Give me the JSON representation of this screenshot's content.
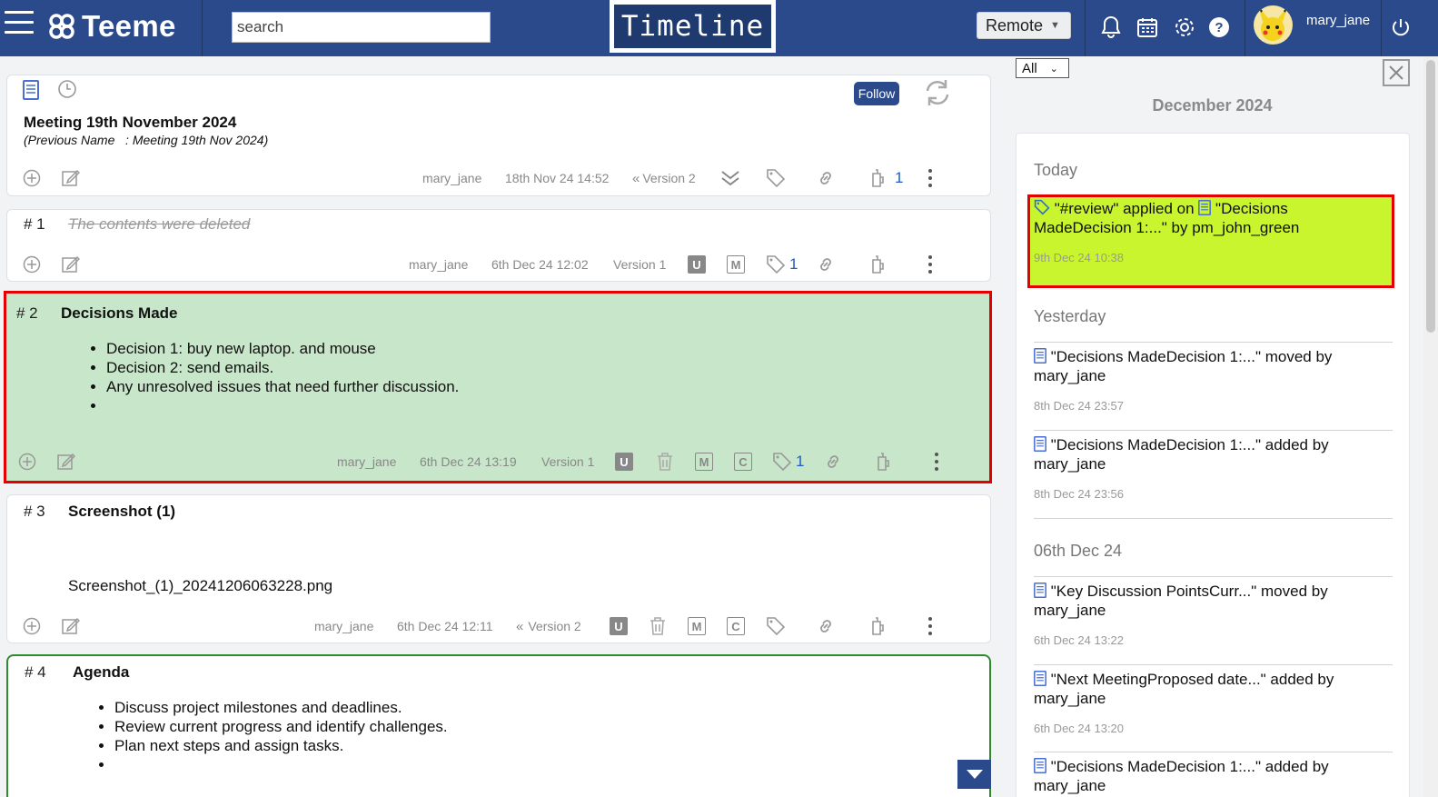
{
  "header": {
    "brand": "Teeme",
    "search_placeholder": "search",
    "page_title": "Timeline",
    "mode_select": "Remote",
    "username": "mary_jane",
    "icons": [
      "bell-icon",
      "calendar-icon",
      "gear-icon",
      "help-icon",
      "power-icon"
    ]
  },
  "document": {
    "title": "Meeting 19th November 2024",
    "previous_name": "(Previous Name   : Meeting 19th Nov 2024)",
    "follow_label": "Follow",
    "author": "mary_jane",
    "date": "18th Nov 24 14:52",
    "version": "Version 2",
    "contrib_count": "1"
  },
  "entries": [
    {
      "num": "# 1",
      "text": "The contents were deleted",
      "author": "mary_jane",
      "date": "6th Dec 24 12:02",
      "version": "Version 1",
      "tag_count": "1"
    },
    {
      "num": "# 2",
      "title": "Decisions Made",
      "bullets": [
        "Decision 1: buy new laptop. and mouse",
        "Decision 2: send emails.",
        "Any unresolved issues that need further discussion.",
        ""
      ],
      "author": "mary_jane",
      "date": "6th Dec 24 13:19",
      "version": "Version 1",
      "tag_count": "1"
    },
    {
      "num": "# 3",
      "title": "Screenshot (1)",
      "file": "Screenshot_(1)_20241206063228.png",
      "author": "mary_jane",
      "date": "6th Dec 24 12:11",
      "version": "Version 2"
    },
    {
      "num": "# 4",
      "title": "Agenda",
      "bullets": [
        "Discuss project milestones and deadlines.",
        "Review current progress and identify challenges.",
        "Plan next steps and assign tasks.",
        ""
      ]
    }
  ],
  "badges": {
    "u": "U",
    "m": "M",
    "c": "C"
  },
  "timeline": {
    "filter": "All",
    "month": "December 2024",
    "groups": [
      {
        "label": "Today",
        "items": [
          {
            "pre": "\"#review\" applied on",
            "text": "\"Decisions MadeDecision 1:...\" by pm_john_green",
            "time": "9th Dec 24 10:38"
          }
        ]
      },
      {
        "label": "Yesterday",
        "items": [
          {
            "text": "\"Decisions MadeDecision 1:...\" moved by mary_jane",
            "time": "8th Dec 24 23:57"
          },
          {
            "text": "\"Decisions MadeDecision 1:...\" added by mary_jane",
            "time": "8th Dec 24 23:56"
          }
        ]
      },
      {
        "label": "06th Dec 24",
        "items": [
          {
            "text": "\"Key Discussion PointsCurr...\" moved by mary_jane",
            "time": "6th Dec 24 13:22"
          },
          {
            "text": "\"Next MeetingProposed date...\" added by mary_jane",
            "time": "6th Dec 24 13:20"
          },
          {
            "text": "\"Decisions MadeDecision 1:...\" added by mary_jane",
            "time": ""
          }
        ]
      }
    ]
  },
  "colors": {
    "header": "#2b4a8b",
    "highlight_bg": "#c9f52e",
    "highlight_border": "#e40000",
    "entry2_bg": "#c8e6c9",
    "entry4_border": "#2e8b2e"
  }
}
